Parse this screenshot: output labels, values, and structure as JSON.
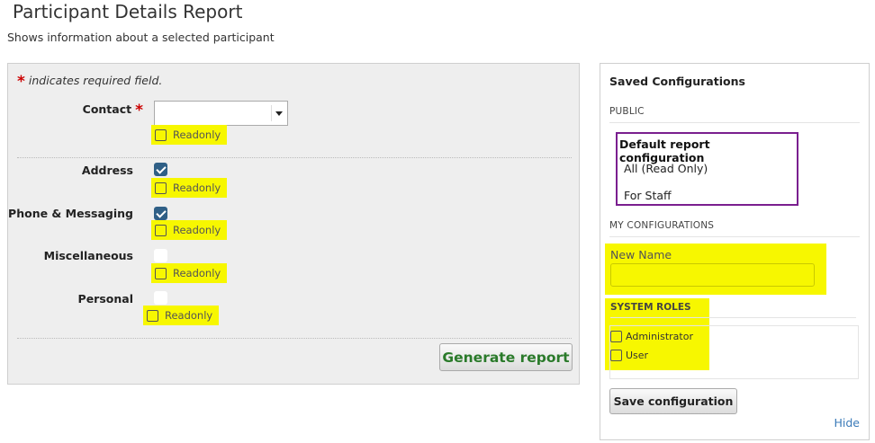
{
  "page": {
    "title": "Participant Details Report",
    "subtitle": "Shows information about a selected participant"
  },
  "form": {
    "required_star": "*",
    "required_note": "indicates required field.",
    "contact_label": "Contact",
    "contact_value": "",
    "readonly_label": "Readonly",
    "fields": [
      {
        "label": "Address",
        "checked": true
      },
      {
        "label": "Phone & Messaging",
        "checked": true
      },
      {
        "label": "Miscellaneous",
        "checked": false
      },
      {
        "label": "Personal",
        "checked": false
      }
    ],
    "generate_button": "Generate report"
  },
  "sidebar": {
    "title": "Saved Configurations",
    "public_title": "PUBLIC",
    "public_items": [
      "Default report configuration",
      "All (Read Only)",
      "For Staff"
    ],
    "my_configs_title": "MY CONFIGURATIONS",
    "new_name_label": "New Name",
    "new_name_value": "",
    "system_roles_title": "SYSTEM ROLES",
    "roles": [
      "Administrator",
      "User"
    ],
    "save_button": "Save configuration",
    "hide_link": "Hide"
  },
  "colors": {
    "highlight": "#f7f700",
    "public_border": "#7a1f8f",
    "generate_text": "#2a7a2a",
    "checkbox_checked": "#2f5f86",
    "required": "#cc0000"
  }
}
